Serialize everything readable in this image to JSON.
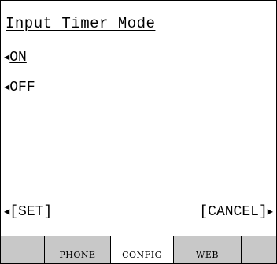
{
  "screen": {
    "title": "Input Timer Mode",
    "options": [
      {
        "arrow": "◀",
        "label": "ON",
        "selected": true
      },
      {
        "arrow": "◀",
        "label": "OFF",
        "selected": false
      }
    ],
    "softkeys": {
      "left": {
        "arrow": "◀",
        "label": "[SET]"
      },
      "right": {
        "arrow": "▶",
        "label": "[CANCEL]"
      }
    },
    "tabs": [
      "",
      "PHONE",
      "CONFIG",
      "WEB",
      ""
    ],
    "active_tab": "CONFIG"
  }
}
